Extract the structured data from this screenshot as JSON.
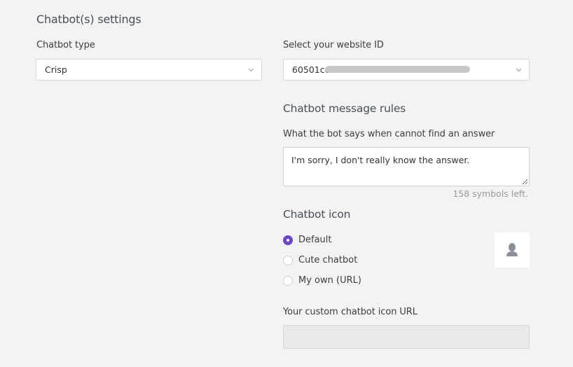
{
  "settings": {
    "title": "Chatbot(s) settings",
    "chatbot_type": {
      "label": "Chatbot type",
      "value": "Crisp"
    },
    "website_id": {
      "label": "Select your website ID",
      "value_visible": "60501cc"
    },
    "message_rules": {
      "heading": "Chatbot message rules",
      "fallback_label": "What the bot says when cannot find an answer",
      "fallback_value": "I'm sorry, I don't really know the answer.",
      "counter": "158 symbols left."
    },
    "chatbot_icon": {
      "heading": "Chatbot icon",
      "options": [
        {
          "label": "Default",
          "checked": true
        },
        {
          "label": "Cute chatbot",
          "checked": false
        },
        {
          "label": "My own (URL)",
          "checked": false
        }
      ],
      "preview_icon": "user-silhouette-icon",
      "custom_url_label": "Your custom chatbot icon URL",
      "custom_url_value": ""
    }
  },
  "colors": {
    "accent": "#6a47c8",
    "background": "#f3f3f3"
  }
}
